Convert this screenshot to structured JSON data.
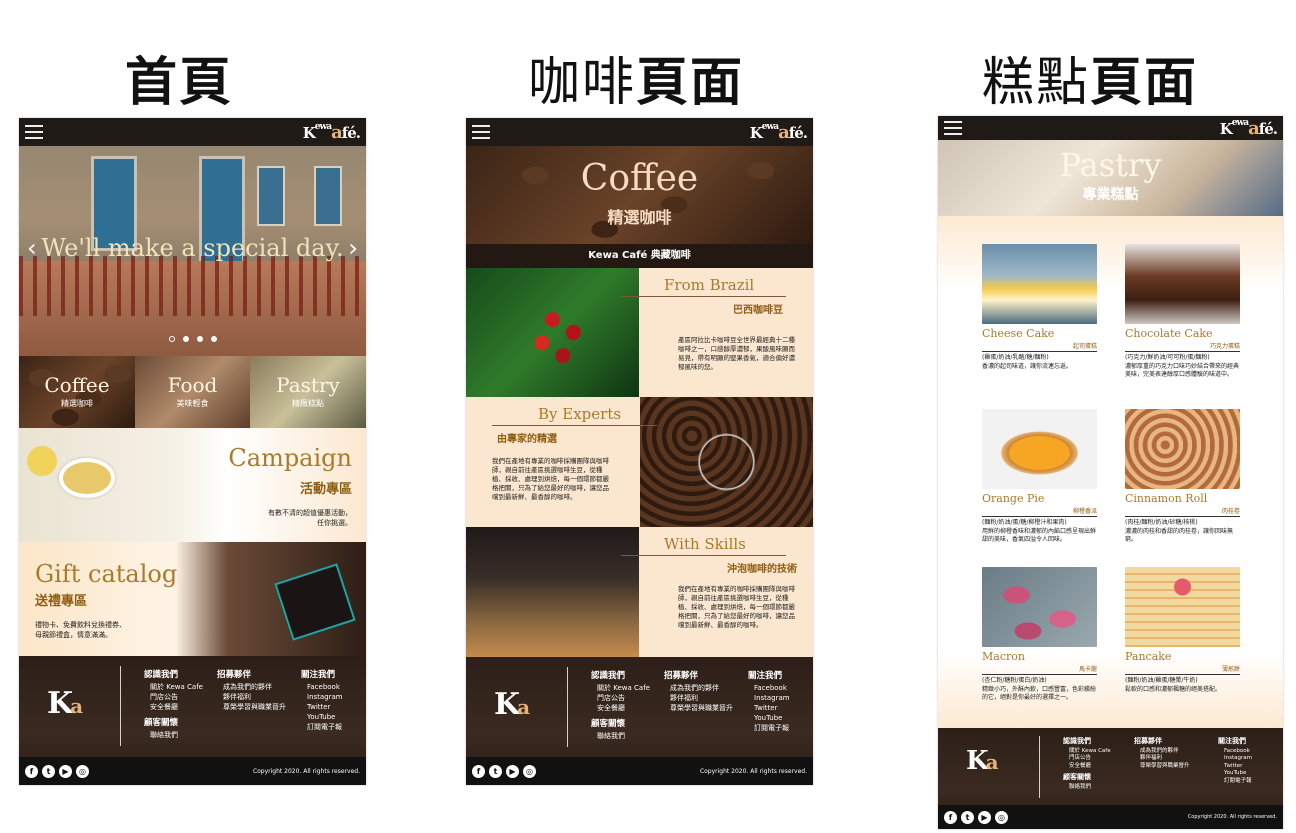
{
  "titles": {
    "home": "首頁",
    "coffee_a": "咖啡",
    "coffee_b": "頁面",
    "pastry_a": "糕點",
    "pastry_b": "頁面"
  },
  "logo": {
    "k": "K",
    "ewa": "ewa",
    "e": "e",
    "a": "a",
    "fe": "fé."
  },
  "home": {
    "hero_text": "We'll make a special day.",
    "prev": "‹",
    "next": "›",
    "tiles": [
      {
        "en": "Coffee",
        "zh": "精選咖啡"
      },
      {
        "en": "Food",
        "zh": "美味輕食"
      },
      {
        "en": "Pastry",
        "zh": "精緻糕點"
      }
    ],
    "campaign": {
      "en": "Campaign",
      "zh": "活動專區",
      "line1": "有數不清的超值優惠活動，",
      "line2": "任你挑選。"
    },
    "gift": {
      "en": "Gift catalog",
      "zh": "送禮專區",
      "line1": "禮物卡、免費飲料兌換禮券、",
      "line2": "母親節禮盒，情意滿滿。"
    }
  },
  "footer": {
    "ka": "K",
    "ka_a": "a",
    "col1_h": "認識我們",
    "col1_items": [
      "關於 Kewa Cafe",
      "門店公告",
      "安全餐廳"
    ],
    "col1b_h": "顧客關懷",
    "col1b_items": [
      "聯絡我們"
    ],
    "col2_h": "招募夥伴",
    "col2_items": [
      "成為我們的夥伴",
      "夥伴福利",
      "尊榮學習與職業晉升"
    ],
    "col3_h": "關注我們",
    "col3_items": [
      "Facebook",
      "Instagram",
      "Twitter",
      "YouTube",
      "訂閱電子報"
    ],
    "copyright_home": "Copyright 2020. All rights reserved.",
    "copyright_coffee": "Copyright 2020. All rights reserved."
  },
  "coffee": {
    "title": "Coffee",
    "subtitle": "精選咖啡",
    "band": "Kewa Café 典藏咖啡",
    "s1": {
      "en": "From Brazil",
      "zh": "巴西咖啡豆",
      "text": "產區阿拉比卡咖啡豆全世界最經典十二種咖啡之一，口感醇厚濃郁，果酸風味顯而易見，帶有明顯的堅果香氣，適合偏好濃郁風味的您。"
    },
    "s2": {
      "en": "By Experts",
      "zh": "由專家的精選",
      "text": "我們在產地有專業的咖啡採購團隊與咖啡師，親自前往產區挑選咖啡生豆，從種植、採收、處理到烘焙，每一個環節都嚴格把關，只為了給您最好的咖啡，讓您品嚐到最新鮮、最香醇的咖啡。"
    },
    "s3": {
      "en": "With Skills",
      "zh": "沖泡咖啡的技術",
      "text": "我們在產地有專業的咖啡採購團隊與咖啡師，親自前往產區挑選咖啡生豆，從種植、採收、處理到烘焙，每一個環節都嚴格把關，只為了給您最好的咖啡，讓您品嚐到最新鮮、最香醇的咖啡。"
    }
  },
  "pastry": {
    "title": "Pastry",
    "subtitle": "專業糕點",
    "items": [
      {
        "en": "Cheese Cake",
        "zh": "起司蛋糕",
        "ing": "(雞蛋/奶油/乳酪/糖/麵粉)",
        "desc": "香濃的起司味道，讓你流連忘返。"
      },
      {
        "en": "Chocolate Cake",
        "zh": "巧克力蛋糕",
        "ing": "(巧克力/鮮奶油/可可粉/蛋/麵粉)",
        "desc": "濃郁厚重的巧克力口味巧妙結合帶來的經典美味，完美表達醇厚口感體驗的味道中。"
      },
      {
        "en": "Orange Pie",
        "zh": "柳橙香派",
        "ing": "(麵粉/奶油/蛋/糖/柳橙汁和果肉)",
        "desc": "用鮮的柳橙香味和濃郁的內餡口感呈現出鮮甜的美味，香氣四溢令人回味。"
      },
      {
        "en": "Cinnamon Roll",
        "zh": "肉桂卷",
        "ing": "(肉桂/麵粉/奶油/砂糖/核桃)",
        "desc": "濃濃的肉桂和香甜的肉桂卷，讓你回味無窮。"
      },
      {
        "en": "Macron",
        "zh": "馬卡龍",
        "ing": "(杏仁粉/糖粉/蛋白/奶油)",
        "desc": "精緻小巧，外酥內軟，口感豐富，色彩繽紛的它，絕對是你最好的選擇之一。"
      },
      {
        "en": "Pancake",
        "zh": "薄煎餅",
        "ing": "(麵粉/奶油/雞蛋/糖漿/牛奶)",
        "desc": "鬆軟的口感和濃郁楓糖的絕美搭配。"
      }
    ],
    "copyright": "Copyright 2020. All rights reserved."
  },
  "colors": {
    "gold": "#a97a2a",
    "dark": "#241912",
    "tan": "#fbe7cf"
  }
}
